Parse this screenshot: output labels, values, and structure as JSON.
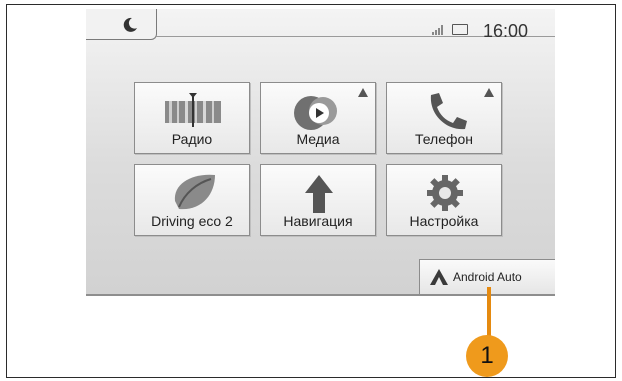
{
  "status_bar": {
    "time": "16:00",
    "icons": [
      "moon-icon",
      "signal-icon",
      "battery-icon"
    ]
  },
  "menu": {
    "tiles": [
      {
        "label": "Радио",
        "icon": "radio-tuner-icon",
        "notification": false
      },
      {
        "label": "Медиа",
        "icon": "media-play-icon",
        "notification": true
      },
      {
        "label": "Телефон",
        "icon": "phone-icon",
        "notification": true
      },
      {
        "label": "Driving eco 2",
        "icon": "eco-leaf-icon",
        "notification": false
      },
      {
        "label": "Навигация",
        "icon": "navigation-arrow-icon",
        "notification": false
      },
      {
        "label": "Настройка",
        "icon": "settings-gear-icon",
        "notification": false
      }
    ]
  },
  "android_auto": {
    "label": "Android Auto",
    "icon": "android-auto-icon"
  },
  "callout": {
    "number": "1",
    "color": "#ef9a1c"
  }
}
